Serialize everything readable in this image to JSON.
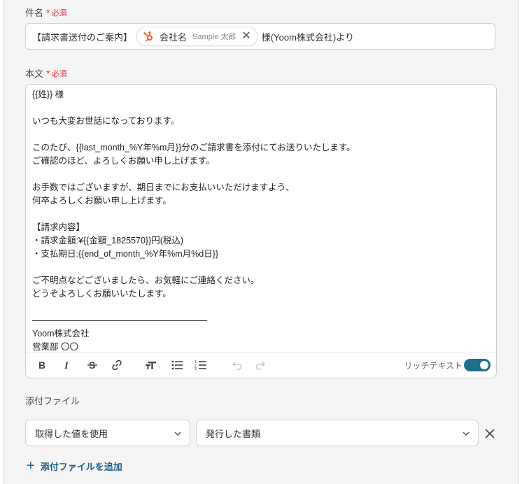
{
  "subject": {
    "label": "件名",
    "required": "必須",
    "prefix": "【請求書送付のご案内】",
    "chip": {
      "label": "会社名",
      "sample": "Sample 太郎",
      "icon": "hubspot-icon"
    },
    "suffix": "様(Yoom株式会社)より"
  },
  "body": {
    "label": "本文",
    "required": "必須",
    "lines": [
      "{{姓}} 様",
      "",
      "いつも大変お世話になっております。",
      "",
      "このたび、{{last_month_%Y年%m月}}分のご請求書を添付にてお送りいたします。",
      "ご確認のほど、よろしくお願い申し上げます。",
      "",
      "お手数ではございますが、期日までにお支払いいただけますよう、",
      "何卒よろしくお願い申し上げます。",
      "",
      "【請求内容】",
      "・請求金額:¥{{金額_1825570}}円(税込)",
      "・支払期日:{{end_of_month_%Y年%m月%d日}}",
      "",
      "ご不明点などございましたら、お気軽にご連絡ください。",
      "どうぞよろしくお願いいたします。",
      "",
      "————————————————————",
      "Yoom株式会社",
      "営業部 〇〇"
    ],
    "toolbar": {
      "rich_text_label": "リッチテキスト",
      "rich_text_on": true,
      "tools": [
        "bold-icon",
        "italic-icon",
        "strikethrough-icon",
        "link-icon",
        "font-size-icon",
        "bullet-list-icon",
        "numbered-list-icon",
        "undo-icon",
        "redo-icon"
      ]
    }
  },
  "attachment": {
    "label": "添付ファイル",
    "source_select": "取得した値を使用",
    "value_select": "発行した書類",
    "add_label": "添付ファイルを追加"
  },
  "colors": {
    "accent": "#1f6f8b",
    "required": "#e0323c",
    "hubspot": "#ff5c35"
  }
}
